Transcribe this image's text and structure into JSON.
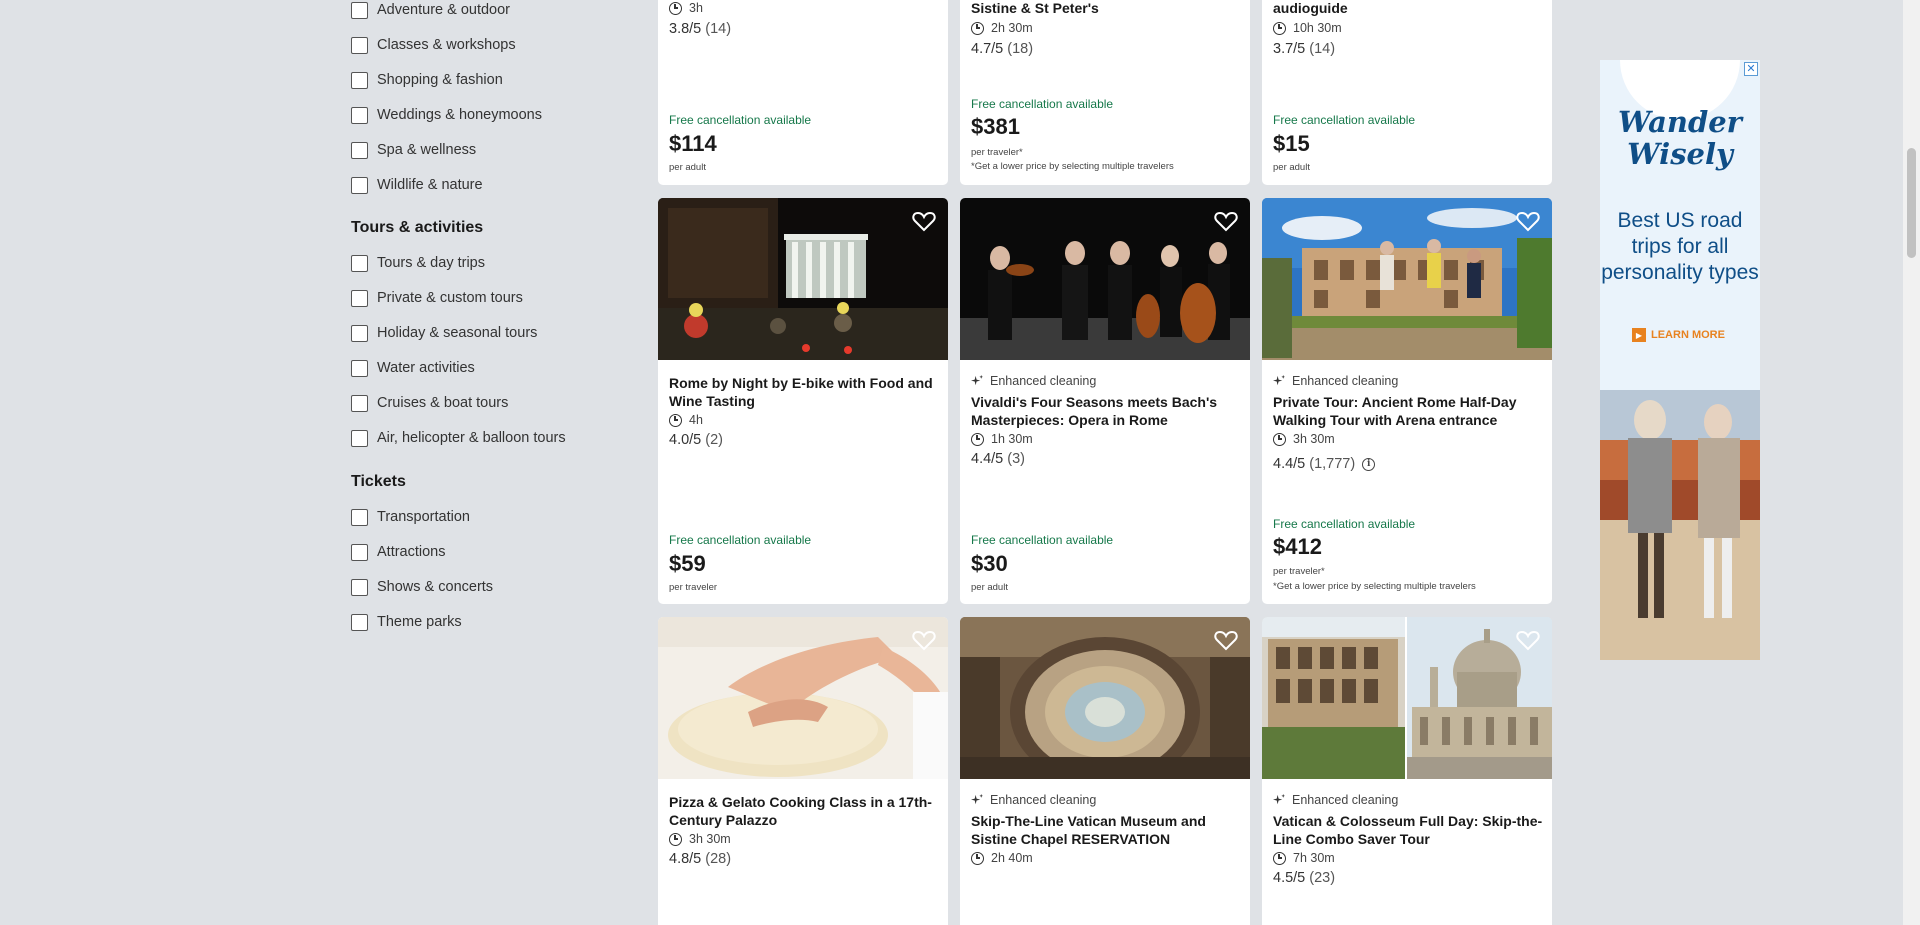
{
  "filters": {
    "top_items": [
      {
        "label": "Adventure & outdoor"
      },
      {
        "label": "Classes & workshops"
      },
      {
        "label": "Shopping & fashion"
      },
      {
        "label": "Weddings & honeymoons"
      },
      {
        "label": "Spa & wellness"
      },
      {
        "label": "Wildlife & nature"
      }
    ],
    "tours_heading": "Tours & activities",
    "tours_items": [
      {
        "label": "Tours & day trips"
      },
      {
        "label": "Private & custom tours"
      },
      {
        "label": "Holiday & seasonal tours"
      },
      {
        "label": "Water activities"
      },
      {
        "label": "Cruises & boat tours"
      },
      {
        "label": "Air, helicopter & balloon tours"
      }
    ],
    "tickets_heading": "Tickets",
    "tickets_items": [
      {
        "label": "Transportation"
      },
      {
        "label": "Attractions"
      },
      {
        "label": "Shows & concerts"
      },
      {
        "label": "Theme parks"
      }
    ]
  },
  "row1": [
    {
      "duration": "3h",
      "rating": "3.8/5",
      "count": "(14)",
      "free_cancel": "Free cancellation available",
      "price": "$114",
      "unit": "per adult"
    },
    {
      "title": "Sistine & St Peter's",
      "duration": "2h 30m",
      "rating": "4.7/5",
      "count": "(18)",
      "free_cancel": "Free cancellation available",
      "price": "$381",
      "unit": "per traveler*",
      "note": "*Get a lower price by selecting multiple travelers"
    },
    {
      "title": "audioguide",
      "duration": "10h 30m",
      "rating": "3.7/5",
      "count": "(14)",
      "free_cancel": "Free cancellation available",
      "price": "$15",
      "unit": "per adult"
    }
  ],
  "row2": [
    {
      "title": "Rome by Night by E-bike with Food and Wine Tasting",
      "duration": "4h",
      "rating": "4.0/5",
      "count": "(2)",
      "free_cancel": "Free cancellation available",
      "price": "$59",
      "unit": "per traveler"
    },
    {
      "badge": "Enhanced cleaning",
      "title": "Vivaldi's Four Seasons meets Bach's Masterpieces: Opera in Rome",
      "duration": "1h 30m",
      "rating": "4.4/5",
      "count": "(3)",
      "free_cancel": "Free cancellation available",
      "price": "$30",
      "unit": "per adult"
    },
    {
      "badge": "Enhanced cleaning",
      "title": "Private Tour: Ancient Rome Half-Day Walking Tour with Arena entrance",
      "duration": "3h 30m",
      "rating": "4.4/5",
      "count": "(1,777)",
      "free_cancel": "Free cancellation available",
      "price": "$412",
      "unit": "per traveler*",
      "note": "*Get a lower price by selecting multiple travelers"
    }
  ],
  "row3": [
    {
      "title": "Pizza & Gelato Cooking Class in a 17th-Century Palazzo",
      "duration": "3h 30m",
      "rating": "4.8/5",
      "count": "(28)"
    },
    {
      "badge": "Enhanced cleaning",
      "title": "Skip-The-Line Vatican Museum and Sistine Chapel RESERVATION",
      "duration": "2h 40m"
    },
    {
      "badge": "Enhanced cleaning",
      "title": "Vatican & Colosseum Full Day: Skip-the-Line Combo Saver Tour",
      "duration": "7h 30m",
      "rating": "4.5/5",
      "count": "(23)"
    }
  ],
  "ad": {
    "close": "✕",
    "brand_line1": "Wander",
    "brand_line2": "Wisely",
    "text": "Best US road trips for all personality types",
    "cta": "LEARN MORE"
  },
  "icons": {
    "heart": "heart-icon",
    "clock": "clock-icon",
    "sparkle": "sparkle-icon",
    "info": "info-icon"
  },
  "colors": {
    "free_cancel": "#16784a",
    "page_bg": "#dfe2e6",
    "ad_blue": "#0f4e87",
    "ad_orange": "#e8821f"
  }
}
